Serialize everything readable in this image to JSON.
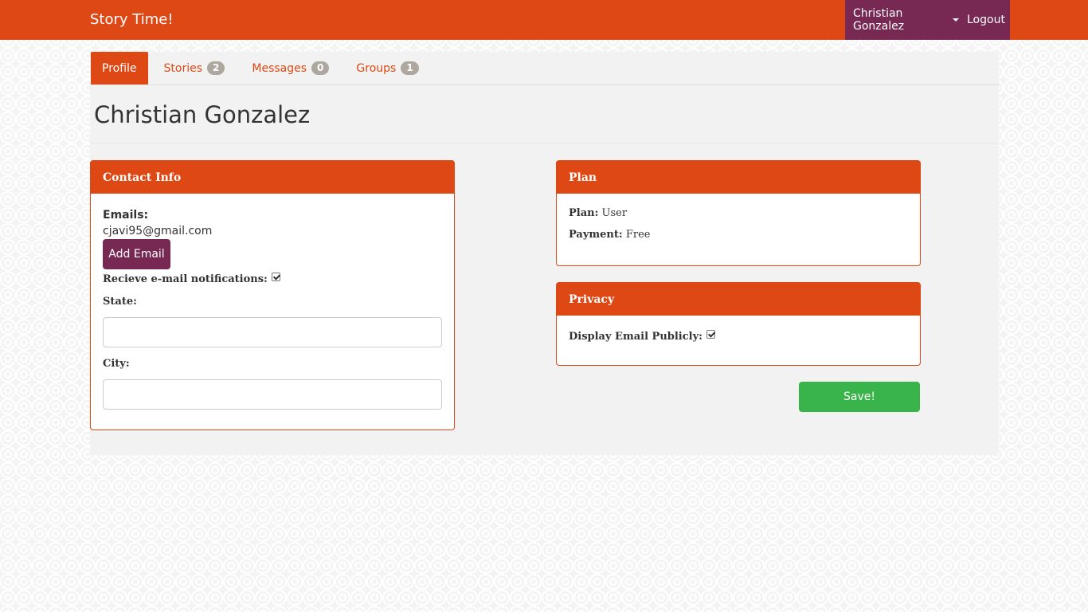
{
  "navbar": {
    "brand": "Story Time!",
    "user_name": "Christian Gonzalez",
    "logout": "Logout"
  },
  "tabs": [
    {
      "label": "Profile",
      "badge": null,
      "active": true
    },
    {
      "label": "Stories",
      "badge": "2"
    },
    {
      "label": "Messages",
      "badge": "0"
    },
    {
      "label": "Groups",
      "badge": "1"
    }
  ],
  "page_title": "Christian Gonzalez",
  "contact": {
    "heading": "Contact Info",
    "emails_label": "Emails:",
    "email": "cjavi95@gmail.com",
    "add_email_label": "Add Email",
    "notifications_label": "Recieve e-mail notifications:",
    "notifications_checked": true,
    "state_label": "State:",
    "state_value": "",
    "city_label": "City:",
    "city_value": ""
  },
  "plan": {
    "heading": "Plan",
    "plan_label": "Plan:",
    "plan_value": "User",
    "payment_label": "Payment:",
    "payment_value": "Free"
  },
  "privacy": {
    "heading": "Privacy",
    "display_email_label": "Display Email Publicly:",
    "display_email_checked": true
  },
  "save_label": "Save!",
  "colors": {
    "primary": "#dd4814",
    "secondary": "#772953",
    "success": "#38b44a"
  }
}
